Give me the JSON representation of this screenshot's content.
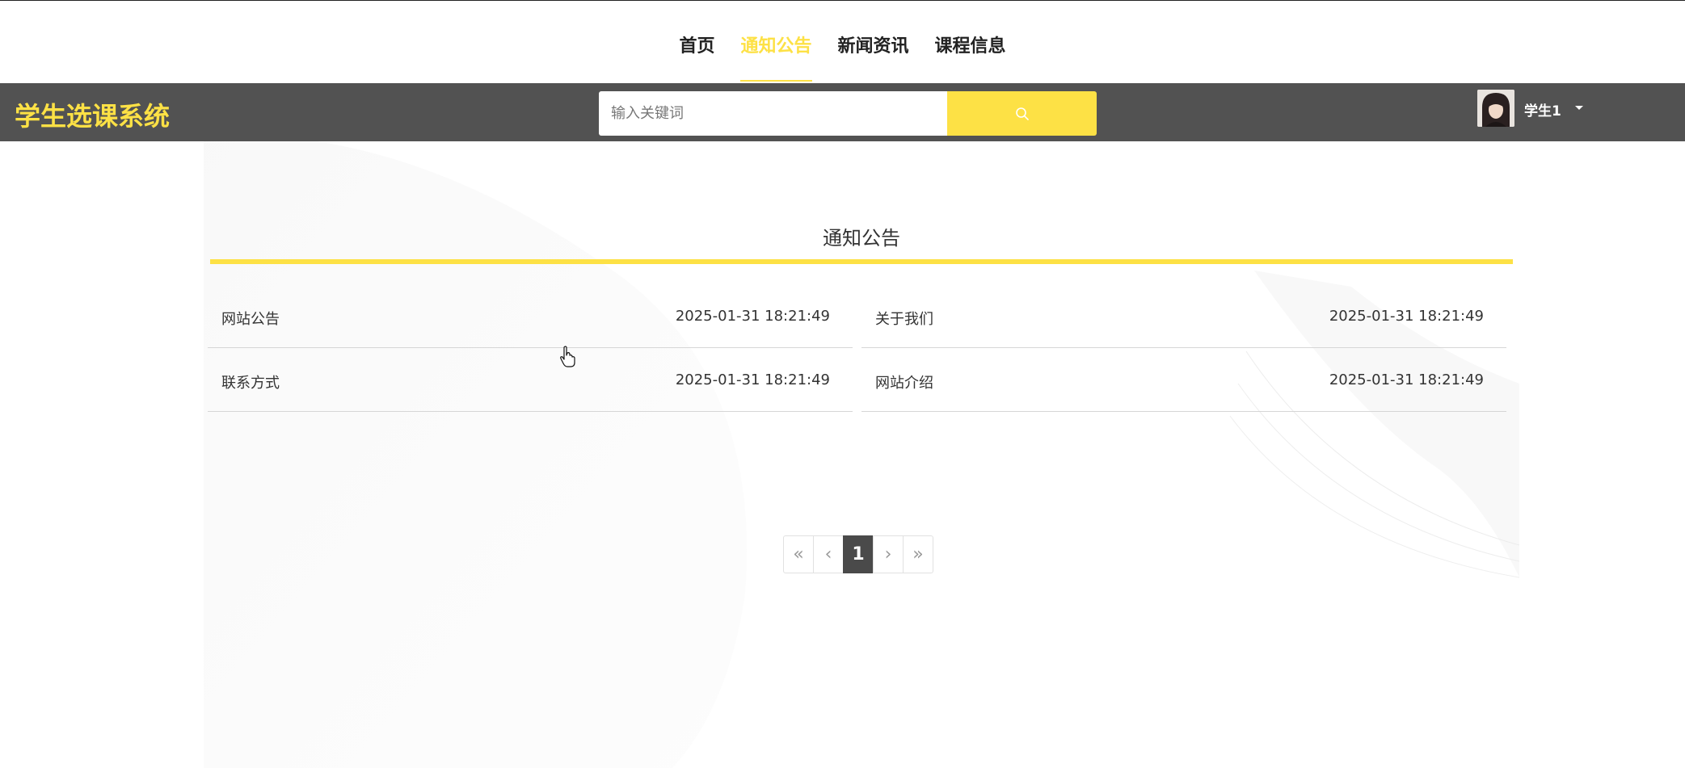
{
  "nav": {
    "items": [
      {
        "label": "首页",
        "active": false
      },
      {
        "label": "通知公告",
        "active": true
      },
      {
        "label": "新闻资讯",
        "active": false
      },
      {
        "label": "课程信息",
        "active": false
      }
    ]
  },
  "header": {
    "logo": "学生选课系统",
    "search_placeholder": "输入关键词",
    "search_icon": "search-icon",
    "user_name": "学生1"
  },
  "section": {
    "title": "通知公告"
  },
  "notices": [
    {
      "title": "网站公告",
      "time": "2025-01-31 18:21:49"
    },
    {
      "title": "关于我们",
      "time": "2025-01-31 18:21:49"
    },
    {
      "title": "联系方式",
      "time": "2025-01-31 18:21:49"
    },
    {
      "title": "网站介绍",
      "time": "2025-01-31 18:21:49"
    }
  ],
  "pagination": {
    "first": "«",
    "prev": "‹",
    "current": "1",
    "next": "›",
    "last": "»"
  },
  "colors": {
    "accent": "#fde145",
    "header_bg": "#525252",
    "page_active_bg": "#4a4a4a"
  }
}
